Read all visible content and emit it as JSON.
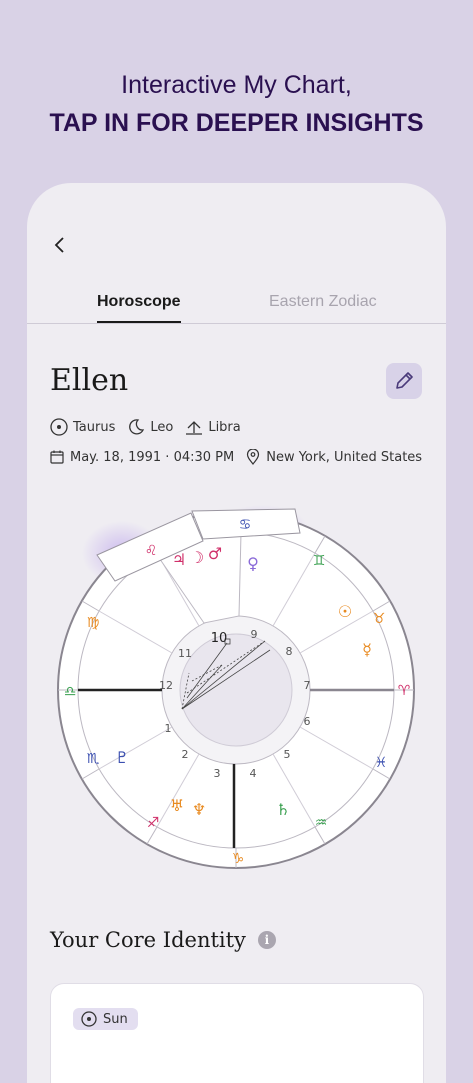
{
  "headline": {
    "line1": "Interactive My Chart,",
    "line2": "TAP IN FOR DEEPER INSIGHTS"
  },
  "tabs": [
    {
      "label": "Horoscope",
      "active": true
    },
    {
      "label": "Eastern Zodiac",
      "active": false
    }
  ],
  "profile": {
    "name": "Ellen",
    "sun": "Taurus",
    "moon": "Leo",
    "rising": "Libra",
    "birth_date": "May. 18, 1991 · 04:30 PM",
    "location": "New York, United States"
  },
  "chart": {
    "houses": [
      "1",
      "2",
      "3",
      "4",
      "5",
      "6",
      "7",
      "8",
      "9",
      "10",
      "11",
      "12"
    ],
    "selected_house": "10"
  },
  "core": {
    "title": "Your Core Identity",
    "badge": "Sun"
  },
  "colors": {
    "accent": "#2a1050",
    "highlight": "#c9b6ee"
  }
}
